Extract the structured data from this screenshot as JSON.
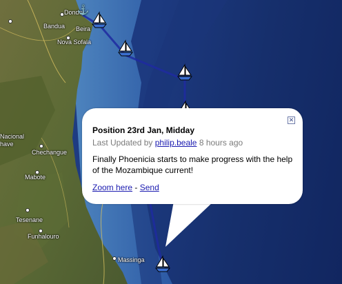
{
  "map": {
    "places": [
      "Dondo",
      "Bandua",
      "Beira",
      "Nova Sofala",
      "Nacional",
      "have",
      "Chechangue",
      "Mabote",
      "Tesenane",
      "Funhalouro",
      "Massinga"
    ]
  },
  "popup": {
    "title": "Position 23rd Jan, Midday",
    "updated_prefix": "Last Updated by",
    "author": "philip.beale",
    "updated_time": "8 hours ago",
    "description": "Finally Phoenicia starts to make progress with the help of the Mozambique current!",
    "zoom_link": "Zoom here",
    "separator": "-",
    "send_link": "Send",
    "close_icon": "close-icon"
  },
  "colors": {
    "route": "#1e2aa0",
    "link": "#1a1ab0"
  }
}
